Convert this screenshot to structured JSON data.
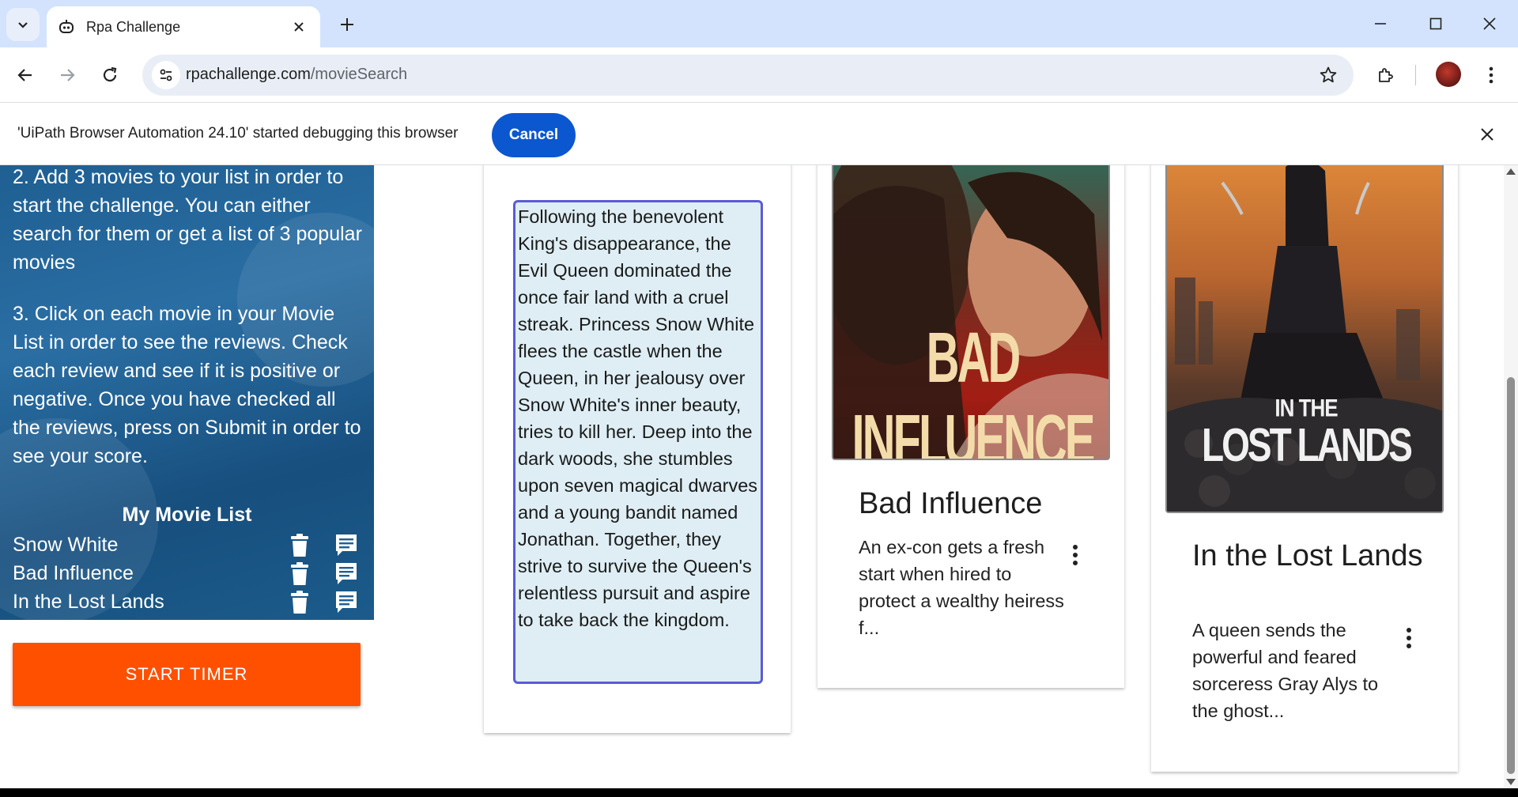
{
  "browser": {
    "tab_title": "Rpa Challenge",
    "url_domain": "rpachallenge.com",
    "url_path": "/movieSearch",
    "icons": [
      "tab-search-icon",
      "robot-favicon-icon",
      "close-icon",
      "plus-icon",
      "minimize-icon",
      "maximize-icon",
      "close-window-icon",
      "back-arrow-icon",
      "forward-arrow-icon",
      "reload-icon",
      "site-info-icon",
      "star-icon",
      "extensions-icon",
      "kebab-menu-icon"
    ]
  },
  "infobar": {
    "message": "'UiPath Browser Automation 24.10' started debugging this browser",
    "cancel_label": "Cancel"
  },
  "sidebar": {
    "step2": "2. Add 3 movies to your list in order to start the challenge. You can either search for them or get a list of 3 popular movies",
    "step3": "3. Click on each movie in your Movie List in order to see the reviews. Check each review and see if it is positive or negative. Once you have checked all the reviews, press on Submit in order to see your score.",
    "list_title": "My Movie List",
    "movies": [
      {
        "name": "Snow White"
      },
      {
        "name": "Bad Influence"
      },
      {
        "name": "In the Lost Lands"
      }
    ],
    "start_timer_label": "START TIMER"
  },
  "cards": [
    {
      "review": "Following the benevolent King's disappearance, the Evil Queen dominated the once fair land with a cruel streak. Princess Snow White flees the castle when the Queen, in her jealousy over Snow White's inner beauty, tries to kill her. Deep into the dark woods, she stumbles upon seven magical dwarves and a young bandit named Jonathan. Together, they strive to survive the Queen's relentless pursuit and aspire to take back the kingdom."
    },
    {
      "poster_text": "BAD INFLUENCE",
      "title": "Bad Influence",
      "description": "An ex-con gets a fresh start when hired to protect a wealthy heiress f..."
    },
    {
      "poster_text_top": "IN THE",
      "poster_text_bottom": "LOST LANDS",
      "title": "In the Lost Lands",
      "description": "A queen sends the powerful and feared sorceress Gray Alys to the ghost..."
    }
  ],
  "colors": {
    "accent_button": "#ff5000",
    "infobar_button": "#0b57d0",
    "review_border": "#5b5bd6",
    "review_bg": "#deeef4",
    "sidebar_blue": "#1f5f92"
  }
}
